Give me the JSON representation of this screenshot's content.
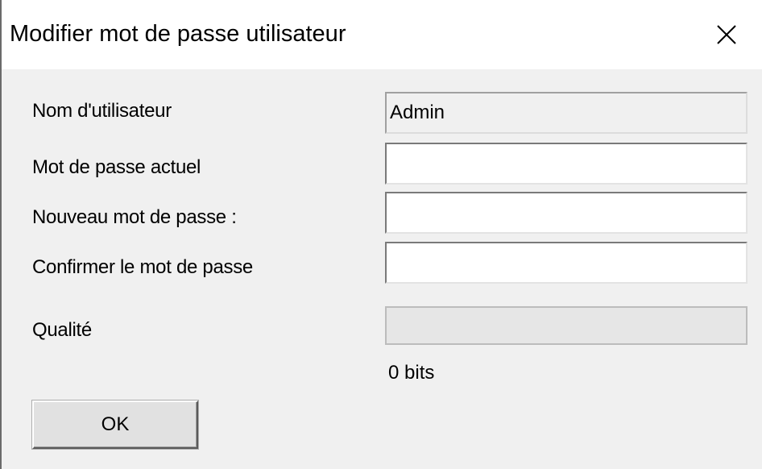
{
  "window": {
    "title": "Modifier mot de passe utilisateur"
  },
  "form": {
    "username_label": "Nom d'utilisateur",
    "username_value": "Admin",
    "current_password_label": "Mot de  passe actuel",
    "current_password_value": "",
    "new_password_label": "Nouveau mot de passe :",
    "new_password_value": "",
    "confirm_password_label": "Confirmer le mot de passe",
    "confirm_password_value": "",
    "quality_label": "Qualité",
    "quality_fraction": 0,
    "quality_bits": "0 bits"
  },
  "buttons": {
    "ok_label": "OK"
  },
  "icons": {
    "close": "close-icon"
  }
}
